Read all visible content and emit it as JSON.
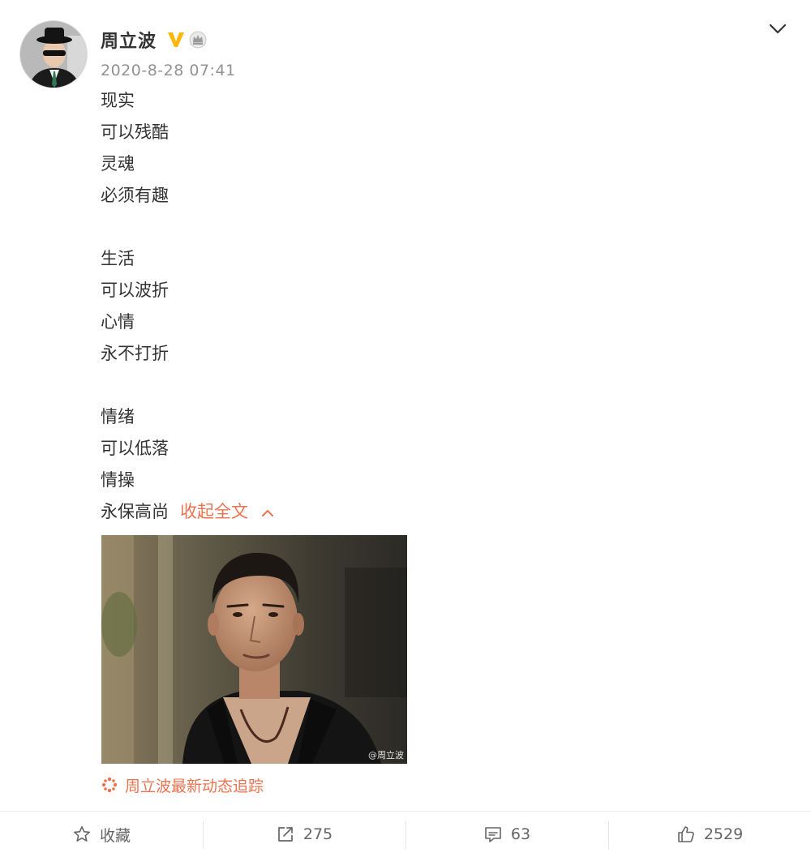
{
  "post": {
    "author": "周立波",
    "timestamp": "2020-8-28 07:41",
    "lines": [
      "现实",
      "可以残酷",
      "灵魂",
      "必须有趣",
      "",
      "生活",
      "可以波折",
      "心情",
      "永不打折",
      "",
      "情绪",
      "可以低落",
      "情操",
      "永保高尚"
    ],
    "collapse_label": "收起全文",
    "image_watermark": "@周立波",
    "topic_label": "周立波最新动态追踪"
  },
  "actions": {
    "favorite_label": "收藏",
    "repost_count": "275",
    "comment_count": "63",
    "like_count": "2529"
  },
  "icons": {
    "verified": "verified-v-icon",
    "crown": "crown-icon",
    "menu": "chevron-down-icon",
    "collapse": "chevron-up-icon",
    "topic": "topic-sparkle-icon",
    "favorite": "star-icon",
    "repost": "share-icon",
    "comment": "comment-icon",
    "like": "thumb-up-icon"
  },
  "colors": {
    "accent": "#eb7350",
    "verified": "#ffb60a",
    "text": "#333333",
    "muted": "#939393"
  }
}
